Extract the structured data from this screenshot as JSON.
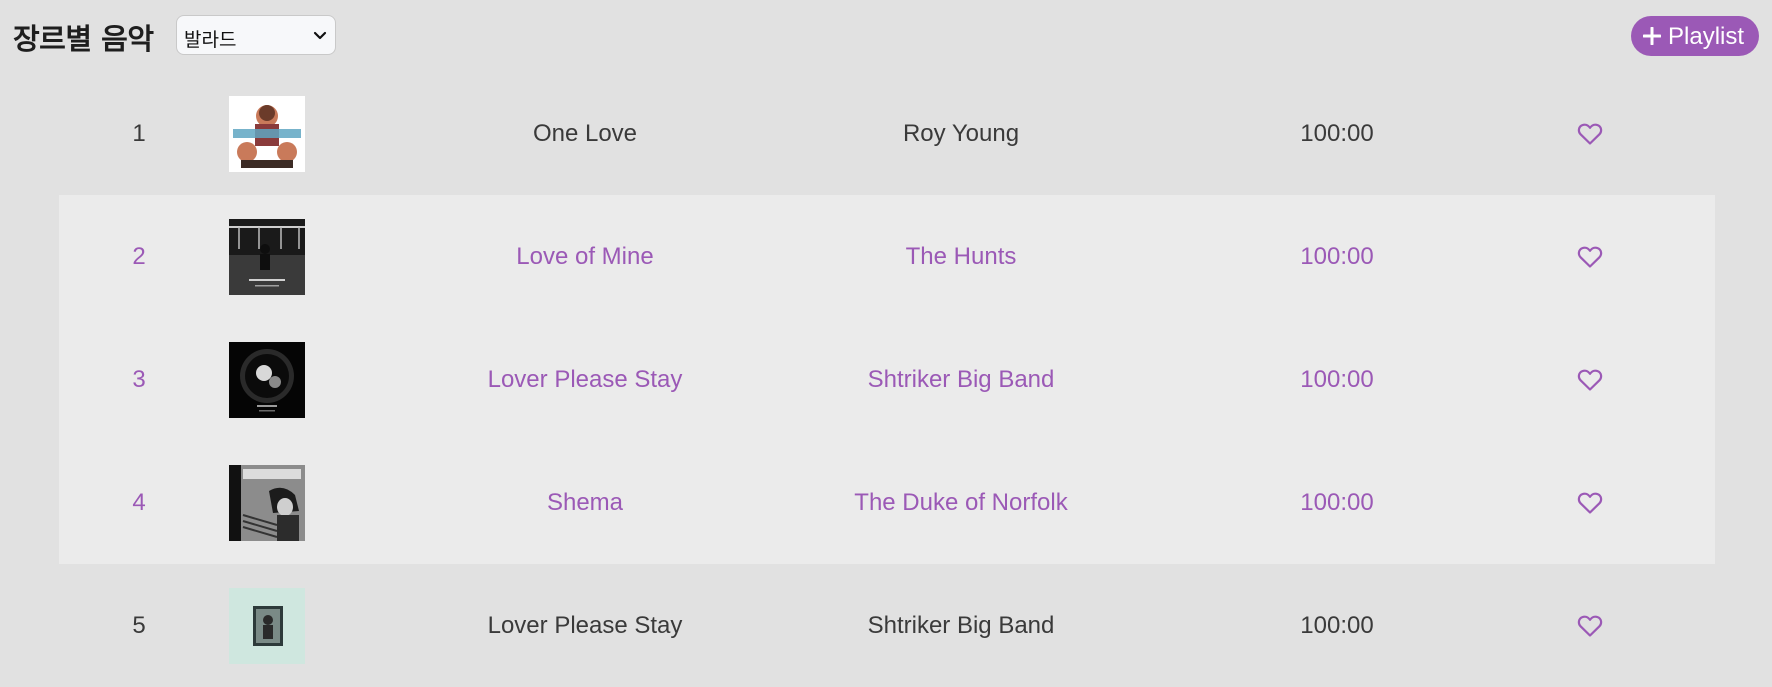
{
  "header": {
    "title": "장르별 음악",
    "genre_select": {
      "value": "발라드"
    },
    "playlist_button": {
      "label": "Playlist",
      "icon": "plus-icon"
    }
  },
  "accent_color": "#9b59b6",
  "tracks": [
    {
      "rank": "1",
      "title": "One Love",
      "artist": "Roy Young",
      "duration": "100:00",
      "highlighted": false,
      "cover_icon": "album-cover-icon",
      "action_icon": "heart-icon"
    },
    {
      "rank": "2",
      "title": "Love of Mine",
      "artist": "The Hunts",
      "duration": "100:00",
      "highlighted": true,
      "cover_icon": "album-cover-icon",
      "action_icon": "heart-icon"
    },
    {
      "rank": "3",
      "title": "Lover Please Stay",
      "artist": "Shtriker Big Band",
      "duration": "100:00",
      "highlighted": true,
      "cover_icon": "album-cover-icon",
      "action_icon": "heart-icon"
    },
    {
      "rank": "4",
      "title": "Shema",
      "artist": "The Duke of Norfolk",
      "duration": "100:00",
      "highlighted": true,
      "cover_icon": "album-cover-icon",
      "action_icon": "heart-icon"
    },
    {
      "rank": "5",
      "title": "Lover Please Stay",
      "artist": "Shtriker Big Band",
      "duration": "100:00",
      "highlighted": false,
      "cover_icon": "album-cover-icon",
      "action_icon": "heart-icon"
    }
  ]
}
